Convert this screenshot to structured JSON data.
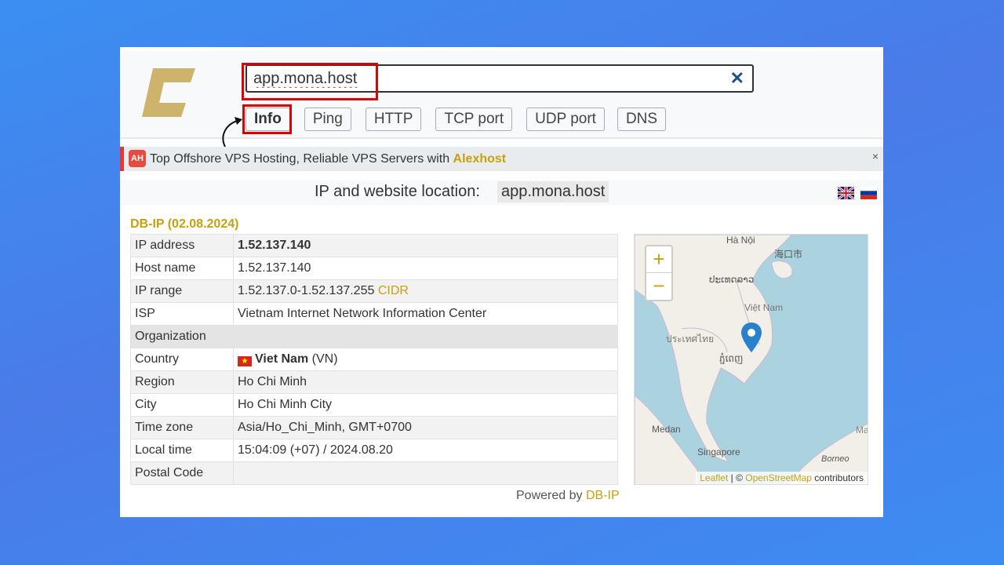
{
  "search": {
    "value": "app.mona.host",
    "clear_icon": "close-icon"
  },
  "tabs": [
    "Info",
    "Ping",
    "HTTP",
    "TCP port",
    "UDP port",
    "DNS"
  ],
  "active_tab": "Info",
  "ad": {
    "text": "Top Offshore VPS Hosting, Reliable VPS Servers with ",
    "brand": "Alexhost",
    "icon_text": "AH",
    "close": "×"
  },
  "title": {
    "label": "IP and website location:",
    "host": "app.mona.host"
  },
  "source": "DB-IP (02.08.2024)",
  "rows": [
    {
      "key": "IP address",
      "value": "1.52.137.140"
    },
    {
      "key": "Host name",
      "value": "1.52.137.140"
    },
    {
      "key": "IP range",
      "value": "1.52.137.0-1.52.137.255",
      "link": "CIDR"
    },
    {
      "key": "ISP",
      "value": "Vietnam Internet Network Information Center"
    },
    {
      "key": "Organization",
      "value": ""
    },
    {
      "key": "Country",
      "value": "Viet Nam",
      "extra": " (VN)"
    },
    {
      "key": "Region",
      "value": "Ho Chi Minh"
    },
    {
      "key": "City",
      "value": "Ho Chi Minh City"
    },
    {
      "key": "Time zone",
      "value": "Asia/Ho_Chi_Minh, GMT+0700"
    },
    {
      "key": "Local time",
      "value": "15:04:09 (+07) / 2024.08.20"
    },
    {
      "key": "Postal Code",
      "value": ""
    }
  ],
  "powered": {
    "text": "Powered by ",
    "link": "DB-IP"
  },
  "map": {
    "zoom_in": "+",
    "zoom_out": "−",
    "labels": [
      "Hà Nội",
      "海口市",
      "ປະເທດລາວ",
      "Việt Nam",
      "ประเทศไทย",
      "ភ្នំពេញ",
      "Medan",
      "Singapore",
      "Borneo",
      "Mal"
    ],
    "attr_leaflet": "Leaflet",
    "attr_sep": " | © ",
    "attr_osm": "OpenStreetMap",
    "attr_tail": " contributors"
  },
  "colors": {
    "accent": "#c8a00c",
    "highlight": "#e30000",
    "marker": "#2a81cb"
  }
}
